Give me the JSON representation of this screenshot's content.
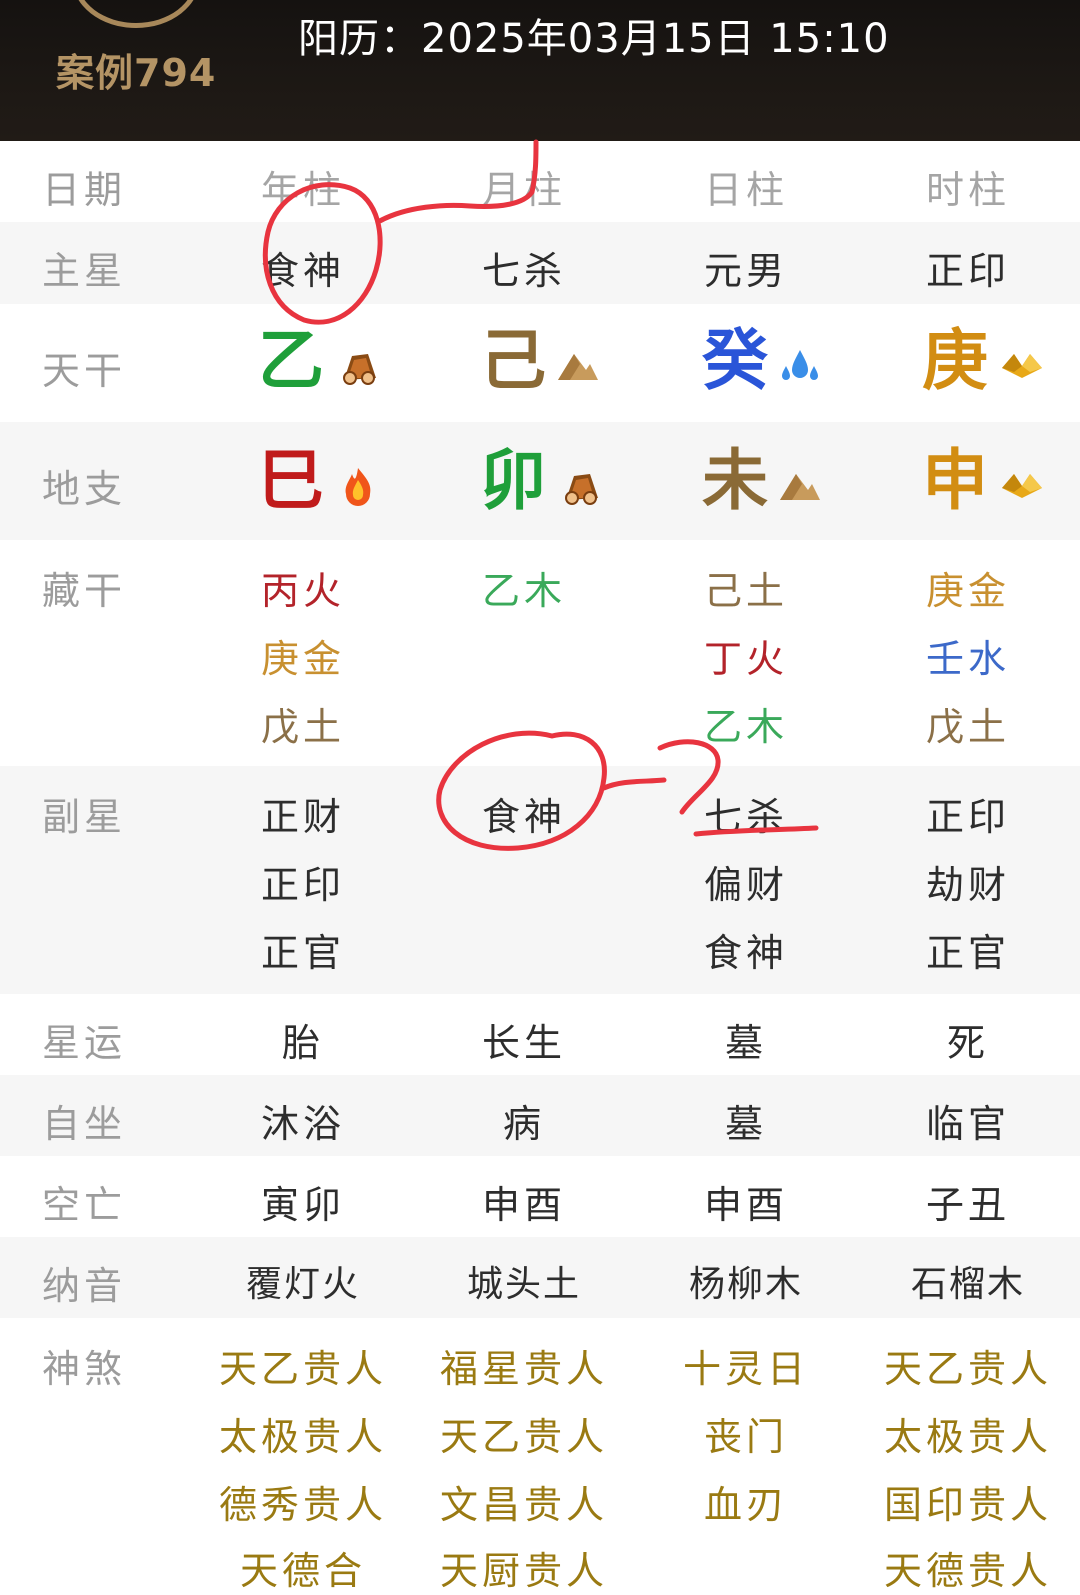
{
  "header": {
    "case_label": "案例794",
    "solar_date": "阳历：2025年03月15日 15:10"
  },
  "columns": {
    "label": "日期",
    "year": "年柱",
    "month": "月柱",
    "day": "日柱",
    "hour": "时柱"
  },
  "main_star": {
    "label": "主星",
    "values": [
      "食神",
      "七杀",
      "元男",
      "正印"
    ]
  },
  "heavenly_stem": {
    "label": "天干",
    "values": [
      "乙",
      "己",
      "癸",
      "庚"
    ],
    "elements": [
      "wood-icon",
      "earth-icon",
      "water-icon",
      "metal-icon"
    ]
  },
  "earthly_branch": {
    "label": "地支",
    "values": [
      "巳",
      "卯",
      "未",
      "申"
    ],
    "elements": [
      "fire-icon",
      "wood-icon",
      "earth-icon",
      "metal-icon"
    ]
  },
  "hidden_stems": {
    "label": "藏干",
    "year": [
      "丙火",
      "庚金",
      "戊土"
    ],
    "month": [
      "乙木"
    ],
    "day": [
      "己土",
      "丁火",
      "乙木"
    ],
    "hour": [
      "庚金",
      "壬水",
      "戊土"
    ]
  },
  "sub_star": {
    "label": "副星",
    "year": [
      "正财",
      "正印",
      "正官"
    ],
    "month": [
      "食神"
    ],
    "day": [
      "七杀",
      "偏财",
      "食神"
    ],
    "hour": [
      "正印",
      "劫财",
      "正官"
    ]
  },
  "star_fortune": {
    "label": "星运",
    "values": [
      "胎",
      "长生",
      "墓",
      "死"
    ]
  },
  "self_sitting": {
    "label": "自坐",
    "values": [
      "沐浴",
      "病",
      "墓",
      "临官"
    ]
  },
  "void": {
    "label": "空亡",
    "values": [
      "寅卯",
      "申酉",
      "申酉",
      "子丑"
    ]
  },
  "nayin": {
    "label": "纳音",
    "values": [
      "覆灯火",
      "城头土",
      "杨柳木",
      "石榴木"
    ]
  },
  "shensha": {
    "label": "神煞",
    "year": [
      "天乙贵人",
      "太极贵人",
      "德秀贵人",
      "天德合"
    ],
    "month": [
      "福星贵人",
      "天乙贵人",
      "文昌贵人",
      "天厨贵人"
    ],
    "day": [
      "十灵日",
      "丧门",
      "血刃"
    ],
    "hour": [
      "天乙贵人",
      "太极贵人",
      "国印贵人",
      "天德贵人"
    ]
  },
  "colors": {
    "header_bg": "#1e1915",
    "gold": "#b49465",
    "wood": "#1f9f3a",
    "fire": "#c01b1b",
    "earth": "#8a6a36",
    "metal": "#d28d12",
    "water": "#2a55d8",
    "annotation": "#e8343f"
  }
}
